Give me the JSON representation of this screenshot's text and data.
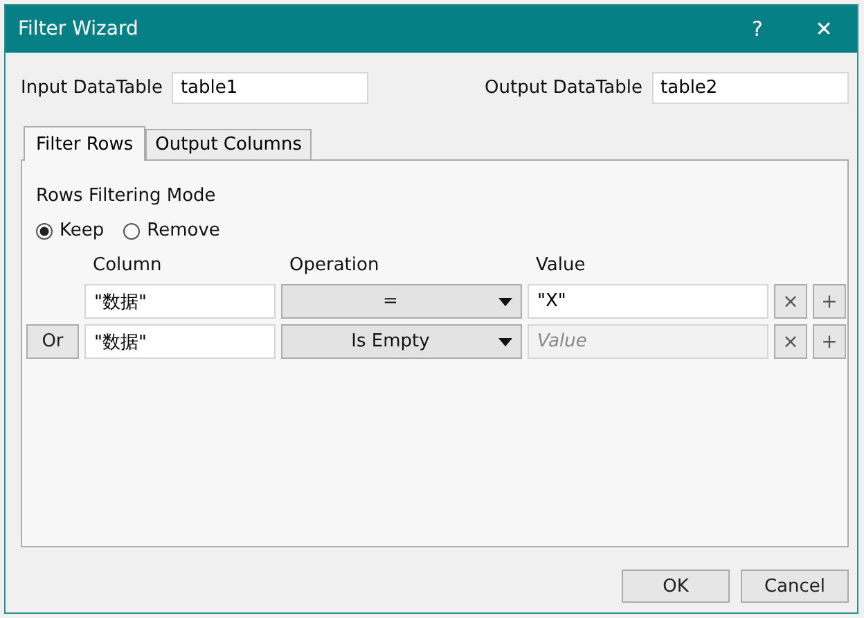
{
  "window": {
    "title": "Filter Wizard",
    "help": "?",
    "close": "✕"
  },
  "input_table": {
    "label": "Input DataTable",
    "value": "table1"
  },
  "output_table": {
    "label": "Output DataTable",
    "value": "table2"
  },
  "tabs": [
    {
      "label": "Filter Rows",
      "selected": true
    },
    {
      "label": "Output Columns",
      "selected": false
    }
  ],
  "mode": {
    "label": "Rows Filtering Mode",
    "options": [
      {
        "label": "Keep",
        "selected": true
      },
      {
        "label": "Remove",
        "selected": false
      }
    ]
  },
  "columns": [
    "Column",
    "Operation",
    "Value"
  ],
  "rows": [
    {
      "column": "\"数据\"",
      "operation": "=",
      "value": "\"X\"",
      "remove": "×",
      "add": "+"
    },
    {
      "connector": "Or",
      "column": "\"数据\"",
      "operation": "Is Empty",
      "placeholder": "Value",
      "remove": "×",
      "add": "+"
    }
  ],
  "buttons": [
    "OK",
    "Cancel"
  ]
}
